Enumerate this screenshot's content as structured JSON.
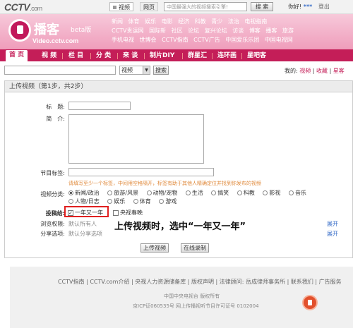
{
  "topbar": {
    "logo_main": "CCTV",
    "logo_suffix": ".com",
    "search_tabs": [
      "视频",
      "网页"
    ],
    "search_placeholder": "中国最强大的视频搜索引擎!",
    "search_button": "搜 索",
    "greeting": "你好!",
    "stars": "***",
    "user_link": "登出"
  },
  "header": {
    "logo_cn": "播客",
    "beta": "beta版",
    "logo_url": "Video.cctv.com",
    "channel_rows": [
      [
        "新闻",
        "体育",
        "娱乐",
        "电影",
        "经济",
        "科教",
        "青少",
        "法治",
        "电视指南"
      ],
      [
        "CCTV贵运网",
        "国际新",
        "社区",
        "论坛",
        "复兴论坛",
        "访谈",
        "博客",
        "播客",
        "旅游"
      ],
      [
        "手机电视",
        "世博会",
        "CCTV指南",
        "CCTV广告",
        "中国爱乐乐团",
        "中国电视网"
      ]
    ]
  },
  "nav": {
    "items": [
      "首 页",
      "视 频",
      "栏 目",
      "分 类",
      "来 谈",
      "制片DIY",
      "群星汇",
      "连环画",
      "星吧客"
    ],
    "active_index": 0
  },
  "search_row": {
    "select_value": "视频",
    "button": "搜索",
    "mine_label": "我的:",
    "mine_links": [
      "视频",
      "收藏",
      "星客"
    ]
  },
  "upload": {
    "heading": "上传视频（第1步，共2步）",
    "title_label": "标　题:",
    "intro_label": "简　介:",
    "tags_label": "节目标签:",
    "tags_hint": "请填写至少一个标签，中间用空格隔开，标签有助于其他人精确定位并找到你发布的视频",
    "category_label": "视频分类:",
    "categories_row1": [
      "新闻/政治",
      "旅游/风景",
      "动物/宠物",
      "生活",
      "搞笑",
      "科教",
      "影视",
      "音乐"
    ],
    "categories_row2": [
      "人物/日志",
      "娱乐",
      "体育",
      "游戏"
    ],
    "selected_category": "新闻/政治",
    "submit_label": "投稿给:",
    "submit_options": [
      {
        "label": "一年又一年",
        "checked": true
      },
      {
        "label": "央视春晚",
        "checked": false
      }
    ],
    "browse_label": "浏览权限:",
    "browse_value": "默认所有人",
    "share_label": "分享选项:",
    "share_value": "默认分享选项",
    "expand_label": "展开",
    "upload_button": "上传视频",
    "record_button": "在线录制",
    "annotation": "上传视频时，选中“一年又一年”"
  },
  "footer": {
    "links": [
      "CCTV指南",
      "CCTV.com介绍",
      "央视人力资源储备库",
      "版权声明",
      "法律顾问: 岳成律师事务所",
      "联系我们",
      "广告服务"
    ],
    "line1": "中国中央电视台 版权所有",
    "line2": "京ICP证060535号  网上传播视听节目许可证号 0102004"
  }
}
